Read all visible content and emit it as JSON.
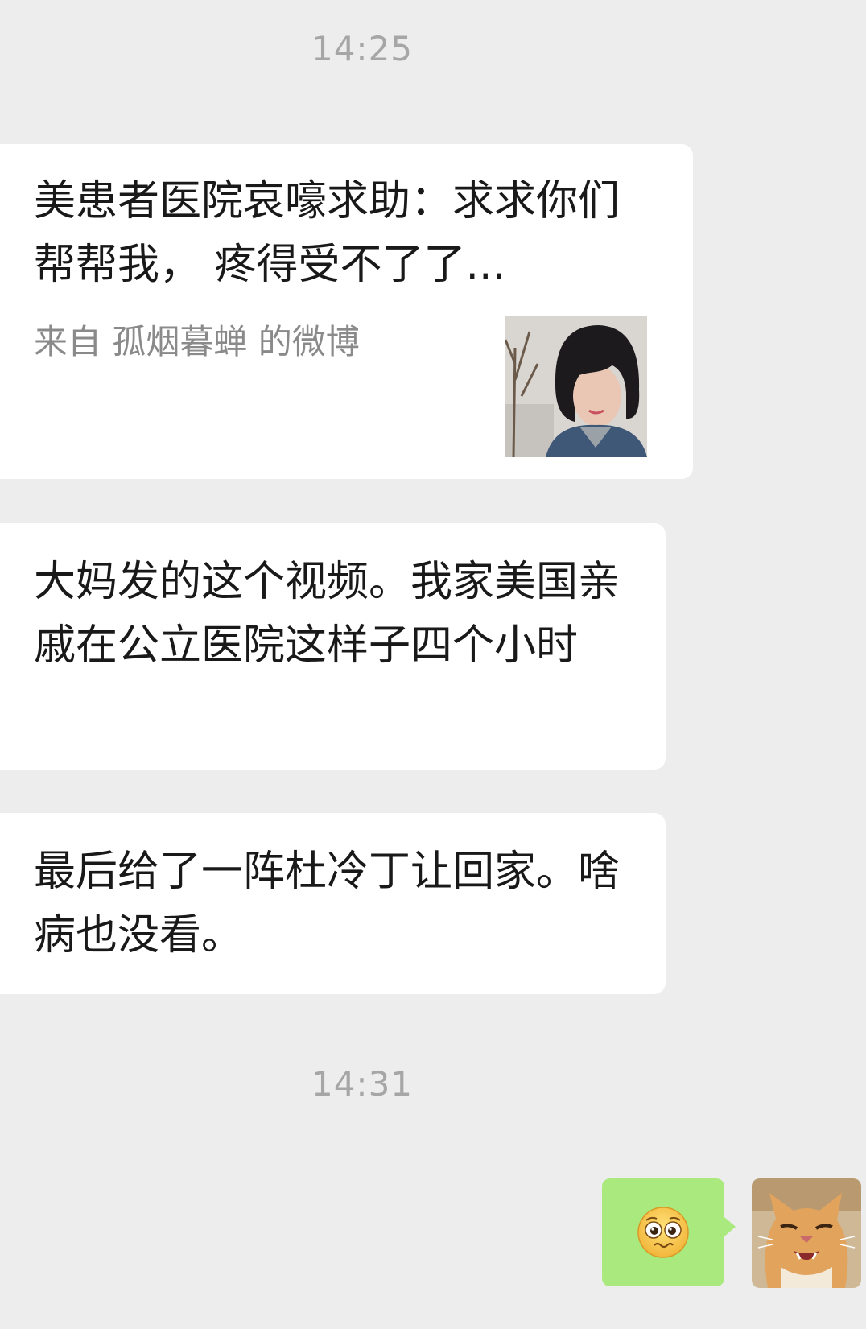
{
  "chat": {
    "timestamps": [
      "14:25",
      "14:31"
    ],
    "share_card": {
      "title": "美患者医院哀嚎求助：求求你们帮帮我， 疼得受不了了...",
      "source": "来自 孤烟暮蝉 的微博",
      "thumbnail_icon": "woman-portrait-photo"
    },
    "messages": [
      {
        "text": "大妈发的这个视频。我家美国亲戚在公立医院这样子四个小时"
      },
      {
        "text": "最后给了一阵杜冷丁让回家。啥病也没看。"
      }
    ],
    "reply": {
      "emoji_icon": "pleading-face-emoji",
      "avatar_icon": "cat-avatar"
    }
  },
  "colors": {
    "background": "#ededed",
    "incoming_bubble": "#ffffff",
    "outgoing_bubble": "#a9e97d",
    "timestamp_text": "#a6a6a6",
    "source_text": "#8a8a8a"
  }
}
